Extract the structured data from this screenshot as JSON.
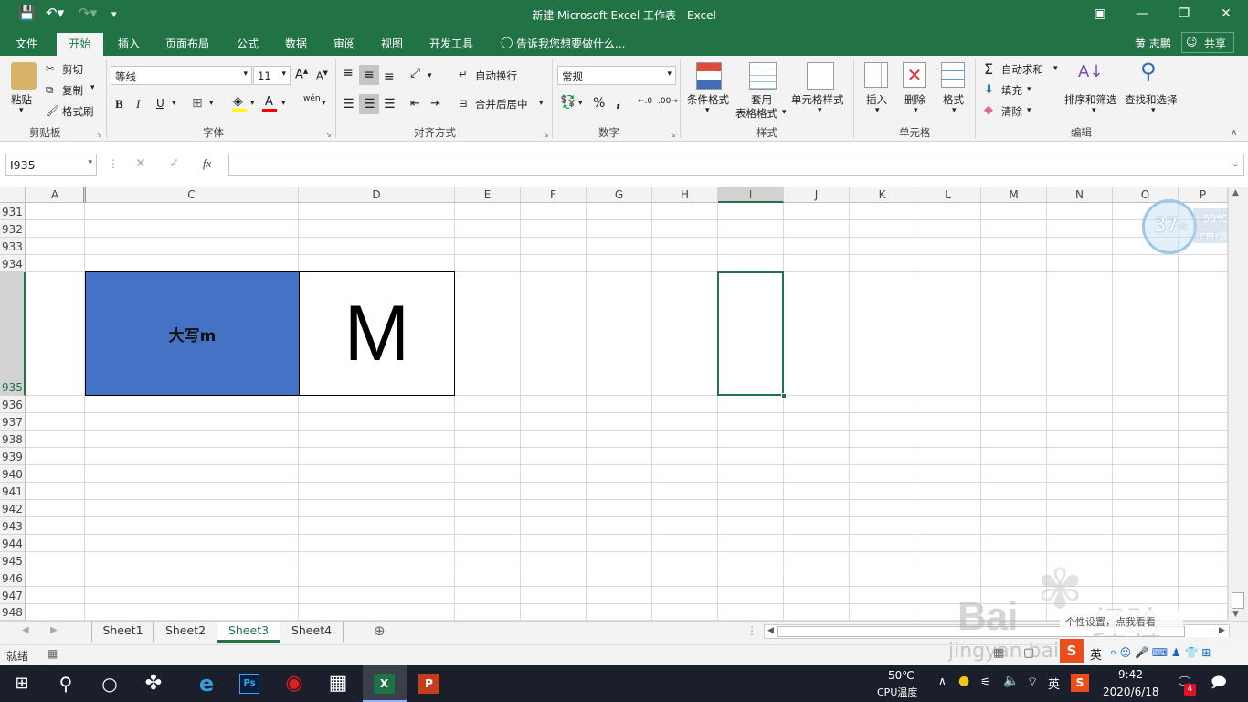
{
  "window": {
    "title": "新建 Microsoft Excel 工作表 - Excel",
    "user": "黄 志鹏",
    "share": "共享"
  },
  "tabs": [
    "文件",
    "开始",
    "插入",
    "页面布局",
    "公式",
    "数据",
    "审阅",
    "视图",
    "开发工具"
  ],
  "tell_me": "告诉我您想要做什么...",
  "ribbon": {
    "clipboard": {
      "paste": "粘贴",
      "cut": "剪切",
      "copy": "复制",
      "format_painter": "格式刷",
      "label": "剪贴板"
    },
    "font": {
      "name": "等线",
      "size": "11",
      "bold": "B",
      "italic": "I",
      "underline": "U",
      "label": "字体",
      "grow": "A",
      "shrink": "A",
      "wen": "wén"
    },
    "alignment": {
      "wrap": "自动换行",
      "merge": "合并后居中",
      "label": "对齐方式"
    },
    "number": {
      "format": "常规",
      "percent": "%",
      "comma": ",",
      "label": "数字"
    },
    "styles": {
      "conditional": "条件格式",
      "table_line1": "套用",
      "table_line2": "表格格式",
      "cell_styles": "单元格样式",
      "label": "样式"
    },
    "cells": {
      "insert": "插入",
      "delete": "删除",
      "format": "格式",
      "label": "单元格"
    },
    "editing": {
      "autosum": "自动求和",
      "fill": "填充",
      "clear": "清除",
      "sort": "排序和筛选",
      "find": "查找和选择",
      "label": "编辑"
    }
  },
  "formula_bar": {
    "name_box": "I935",
    "cancel": "✕",
    "enter": "✓",
    "fx": "fx",
    "value": ""
  },
  "columns": [
    "A",
    "C",
    "D",
    "E",
    "F",
    "G",
    "H",
    "I",
    "J",
    "K",
    "L",
    "M",
    "N",
    "O",
    "P"
  ],
  "rows": [
    "931",
    "932",
    "933",
    "934",
    "935",
    "936",
    "937",
    "938",
    "939",
    "940",
    "941",
    "942",
    "943",
    "944",
    "945",
    "946",
    "947",
    "948"
  ],
  "cells": {
    "C935": "大写m",
    "D935": "M"
  },
  "colors": {
    "excel_green": "#217346",
    "cell_blue": "#4472c4"
  },
  "sheets": [
    "Sheet1",
    "Sheet2",
    "Sheet3",
    "Sheet4"
  ],
  "active_sheet": "Sheet3",
  "status": {
    "ready": "就绪"
  },
  "cpu_widget": {
    "percent": "37",
    "pct_sign": "%",
    "temp": "50℃",
    "label": "CPU温度"
  },
  "watermark": {
    "line1": "Bai",
    "line2": "经验",
    "url": "jingyan.baidu.com",
    "notice": "个性设置，点我看看"
  },
  "taskbar": {
    "cpu_temp": "50℃",
    "cpu_label": "CPU温度",
    "time": "9:42",
    "date": "2020/6/18",
    "ime": "英",
    "notif_count": "4"
  }
}
